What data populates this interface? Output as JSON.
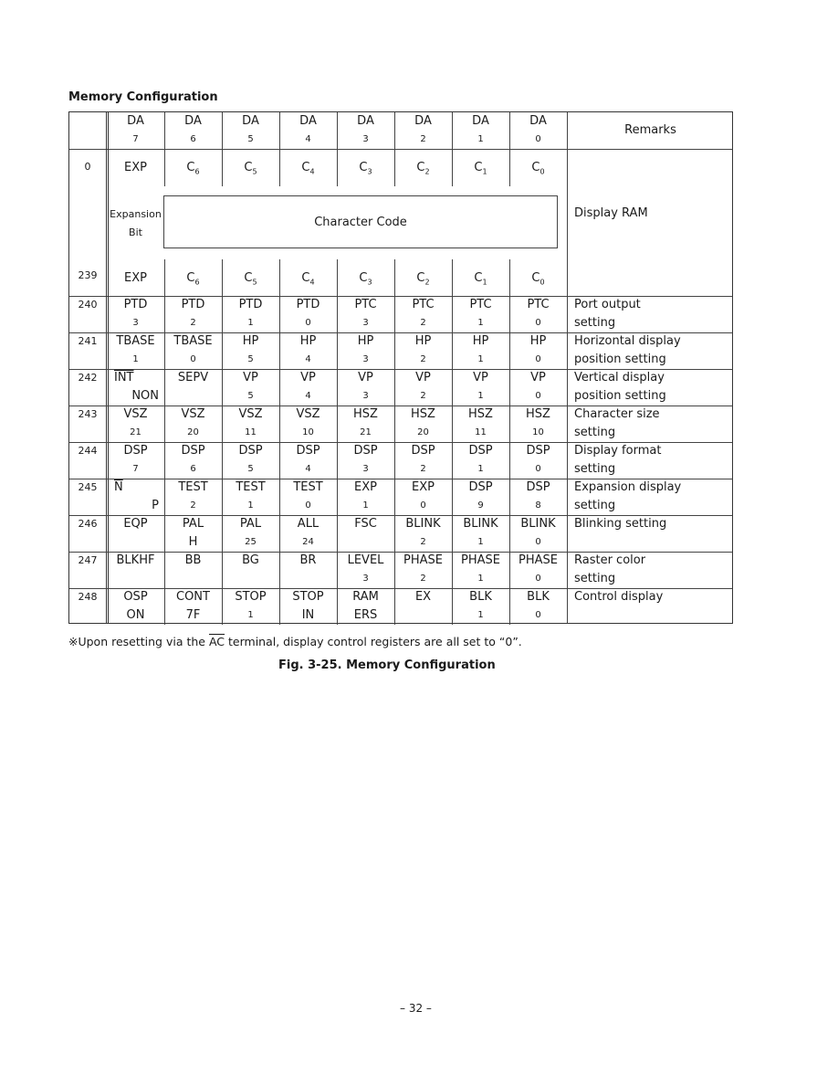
{
  "title": "Memory Configuration",
  "header": {
    "columns": [
      {
        "label": "DA",
        "bit": "7"
      },
      {
        "label": "DA",
        "bit": "6"
      },
      {
        "label": "DA",
        "bit": "5"
      },
      {
        "label": "DA",
        "bit": "4"
      },
      {
        "label": "DA",
        "bit": "3"
      },
      {
        "label": "DA",
        "bit": "2"
      },
      {
        "label": "DA",
        "bit": "1"
      },
      {
        "label": "DA",
        "bit": "0"
      }
    ],
    "remarks": "Remarks"
  },
  "ram_block": {
    "first_address": "0",
    "last_address": "239",
    "top_cells": [
      "EXP",
      "C6",
      "C5",
      "C4",
      "C3",
      "C2",
      "C1",
      "C0"
    ],
    "bottom_cells": [
      "EXP",
      "C6",
      "C5",
      "C4",
      "C3",
      "C2",
      "C1",
      "C0"
    ],
    "expansion_bit_line1": "Expansion",
    "expansion_bit_line2": "Bit",
    "character_code": "Character Code",
    "remark": "Display RAM"
  },
  "rows": [
    {
      "address": "240",
      "cells": [
        [
          "PTD",
          "3"
        ],
        [
          "PTD",
          "2"
        ],
        [
          "PTD",
          "1"
        ],
        [
          "PTD",
          "0"
        ],
        [
          "PTC",
          "3"
        ],
        [
          "PTC",
          "2"
        ],
        [
          "PTC",
          "1"
        ],
        [
          "PTC",
          "0"
        ]
      ],
      "remark": [
        "Port output",
        "setting"
      ]
    },
    {
      "address": "241",
      "cells": [
        [
          "TBASE",
          "1"
        ],
        [
          "TBASE",
          "0"
        ],
        [
          "HP",
          "5"
        ],
        [
          "HP",
          "4"
        ],
        [
          "HP",
          "3"
        ],
        [
          "HP",
          "2"
        ],
        [
          "HP",
          "1"
        ],
        [
          "HP",
          "0"
        ]
      ],
      "remark": [
        "Horizontal display",
        "position setting"
      ]
    },
    {
      "address": "242",
      "cells": [
        [
          "INT",
          "NON"
        ],
        [
          "SEPV",
          ""
        ],
        [
          "VP",
          "5"
        ],
        [
          "VP",
          "4"
        ],
        [
          "VP",
          "3"
        ],
        [
          "VP",
          "2"
        ],
        [
          "VP",
          "1"
        ],
        [
          "VP",
          "0"
        ]
      ],
      "remark": [
        "Vertical display",
        "position setting"
      ]
    },
    {
      "address": "243",
      "cells": [
        [
          "VSZ",
          "21"
        ],
        [
          "VSZ",
          "20"
        ],
        [
          "VSZ",
          "11"
        ],
        [
          "VSZ",
          "10"
        ],
        [
          "HSZ",
          "21"
        ],
        [
          "HSZ",
          "20"
        ],
        [
          "HSZ",
          "11"
        ],
        [
          "HSZ",
          "10"
        ]
      ],
      "remark": [
        "Character size",
        "setting"
      ]
    },
    {
      "address": "244",
      "cells": [
        [
          "DSP",
          "7"
        ],
        [
          "DSP",
          "6"
        ],
        [
          "DSP",
          "5"
        ],
        [
          "DSP",
          "4"
        ],
        [
          "DSP",
          "3"
        ],
        [
          "DSP",
          "2"
        ],
        [
          "DSP",
          "1"
        ],
        [
          "DSP",
          "0"
        ]
      ],
      "remark": [
        "Display format",
        "setting"
      ]
    },
    {
      "address": "245",
      "cells": [
        [
          "N",
          "P"
        ],
        [
          "TEST",
          "2"
        ],
        [
          "TEST",
          "1"
        ],
        [
          "TEST",
          "0"
        ],
        [
          "EXP",
          "1"
        ],
        [
          "EXP",
          "0"
        ],
        [
          "DSP",
          "9"
        ],
        [
          "DSP",
          "8"
        ]
      ],
      "remark": [
        "Expansion display",
        "setting"
      ]
    },
    {
      "address": "246",
      "cells": [
        [
          "EQP",
          ""
        ],
        [
          "PAL",
          "H"
        ],
        [
          "PAL",
          "25"
        ],
        [
          "ALL",
          "24"
        ],
        [
          "FSC",
          ""
        ],
        [
          "BLINK",
          "2"
        ],
        [
          "BLINK",
          "1"
        ],
        [
          "BLINK",
          "0"
        ]
      ],
      "remark": [
        "Blinking setting",
        ""
      ]
    },
    {
      "address": "247",
      "cells": [
        [
          "BLKHF",
          ""
        ],
        [
          "BB",
          ""
        ],
        [
          "BG",
          ""
        ],
        [
          "BR",
          ""
        ],
        [
          "LEVEL",
          "3"
        ],
        [
          "PHASE",
          "2"
        ],
        [
          "PHASE",
          "1"
        ],
        [
          "PHASE",
          "0"
        ]
      ],
      "remark": [
        "Raster color",
        "setting"
      ]
    },
    {
      "address": "248",
      "cells": [
        [
          "OSP",
          "ON"
        ],
        [
          "CONT",
          "7F"
        ],
        [
          "STOP",
          "1"
        ],
        [
          "STOP",
          "IN"
        ],
        [
          "RAM",
          "ERS"
        ],
        [
          "EX",
          ""
        ],
        [
          "BLK",
          "1"
        ],
        [
          "BLK",
          "0"
        ]
      ],
      "remark": [
        "Control display",
        ""
      ]
    }
  ],
  "note": {
    "prefix": "※Upon resetting via the ",
    "overlined": "AC",
    "suffix": " terminal, display control registers are all set to “0”."
  },
  "caption": "Fig. 3-25.   Memory Configuration",
  "page_number": "– 32 –"
}
